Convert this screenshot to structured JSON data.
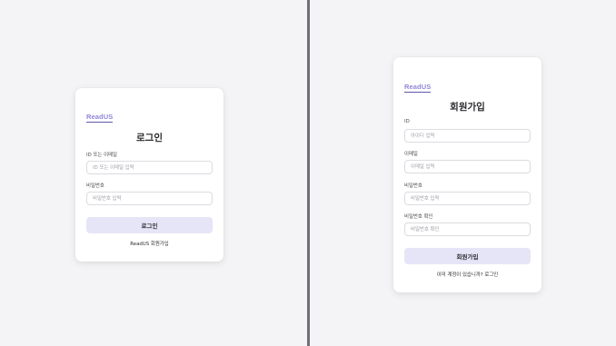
{
  "login": {
    "brand": "ReadUS",
    "title": "로그인",
    "id_label": "ID 또는 이메일",
    "id_placeholder": "ID 또는 이메일 입력",
    "password_label": "비밀번호",
    "password_placeholder": "비밀번호 입력",
    "submit_label": "로그인",
    "signup_link": "ReadUS 회원가입"
  },
  "signup": {
    "brand": "ReadUS",
    "title": "회원가입",
    "id_label": "ID",
    "id_placeholder": "아이디 입력",
    "email_label": "이메일",
    "email_placeholder": "이메일 입력",
    "password_label": "비밀번호",
    "password_placeholder": "비밀번호 입력",
    "password_confirm_label": "비밀번호 확인",
    "password_confirm_placeholder": "비밀번호 확인",
    "submit_label": "회원가입",
    "login_link": "이미 계정이 있습니까? 로그인"
  },
  "colors": {
    "brand": "#8f86d8",
    "button_bg": "#e6e5f7",
    "divider": "#6f6f74"
  }
}
